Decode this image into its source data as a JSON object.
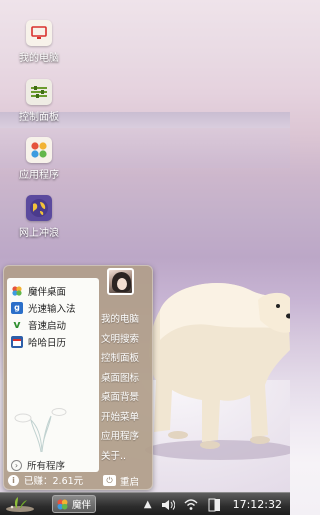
{
  "desktop": {
    "icons": [
      {
        "label": "我的电脑",
        "icon": "computer-icon"
      },
      {
        "label": "控制面板",
        "icon": "control-panel-icon"
      },
      {
        "label": "应用程序",
        "icon": "apps-icon"
      },
      {
        "label": "网上冲浪",
        "icon": "globe-icon"
      }
    ]
  },
  "start_menu": {
    "programs": [
      {
        "label": "魔伴桌面",
        "icon": "mobanzhuomian-icon"
      },
      {
        "label": "光速输入法",
        "icon": "input-method-icon"
      },
      {
        "label": "音速启动",
        "icon": "vstart-icon"
      },
      {
        "label": "哈哈日历",
        "icon": "calendar-icon"
      }
    ],
    "all_programs": "所有程序",
    "links": [
      "我的电脑",
      "文明搜索",
      "控制面板",
      "桌面图标",
      "桌面背景",
      "开始菜单",
      "应用程序",
      "关于.."
    ],
    "earned": "已赚：2.61元",
    "restart": "重启"
  },
  "taskbar": {
    "task_label": "魔伴",
    "clock": "17:12:32"
  },
  "colors": {
    "menu_bg": "#b09e8a",
    "taskbar": "#2d2d2d"
  }
}
